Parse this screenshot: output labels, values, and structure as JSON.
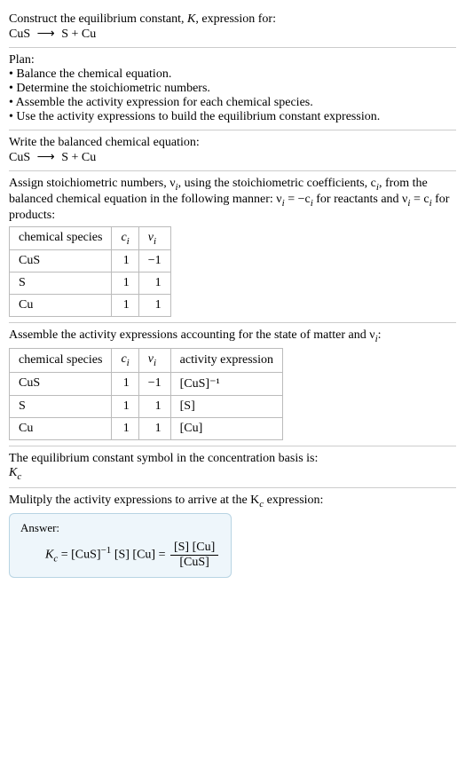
{
  "header": {
    "line1": "Construct the equilibrium constant, K, expression for:",
    "eq_lhs": "CuS",
    "eq_arrow": "⟶",
    "eq_rhs": "S + Cu"
  },
  "plan": {
    "title": "Plan:",
    "items": [
      "• Balance the chemical equation.",
      "• Determine the stoichiometric numbers.",
      "• Assemble the activity expression for each chemical species.",
      "• Use the activity expressions to build the equilibrium constant expression."
    ]
  },
  "balanced": {
    "title": "Write the balanced chemical equation:",
    "eq_lhs": "CuS",
    "eq_arrow": "⟶",
    "eq_rhs": "S + Cu"
  },
  "stoich": {
    "intro_a": "Assign stoichiometric numbers, ν",
    "intro_b": ", using the stoichiometric coefficients, c",
    "intro_c": ", from the balanced chemical equation in the following manner: ν",
    "intro_d": " = −c",
    "intro_e": " for reactants and ν",
    "intro_f": " = c",
    "intro_g": " for products:",
    "headers": {
      "species": "chemical species",
      "c": "c",
      "nu": "ν"
    },
    "rows": [
      {
        "species": "CuS",
        "c": "1",
        "nu": "−1"
      },
      {
        "species": "S",
        "c": "1",
        "nu": "1"
      },
      {
        "species": "Cu",
        "c": "1",
        "nu": "1"
      }
    ]
  },
  "activity": {
    "intro_a": "Assemble the activity expressions accounting for the state of matter and ν",
    "intro_b": ":",
    "headers": {
      "species": "chemical species",
      "c": "c",
      "nu": "ν",
      "act": "activity expression"
    },
    "rows": [
      {
        "species": "CuS",
        "c": "1",
        "nu": "−1",
        "act": "[CuS]⁻¹"
      },
      {
        "species": "S",
        "c": "1",
        "nu": "1",
        "act": "[S]"
      },
      {
        "species": "Cu",
        "c": "1",
        "nu": "1",
        "act": "[Cu]"
      }
    ]
  },
  "symbol": {
    "line1": "The equilibrium constant symbol in the concentration basis is:",
    "Kc_K": "K",
    "Kc_c": "c"
  },
  "multiply": {
    "intro_a": "Mulitply the activity expressions to arrive at the K",
    "intro_b": " expression:"
  },
  "answer": {
    "label": "Answer:",
    "K": "K",
    "c": "c",
    "eq": " = ",
    "term1": "[CuS]",
    "exp1": "−1",
    "term2": " [S] [Cu] = ",
    "frac_num": "[S] [Cu]",
    "frac_den": "[CuS]"
  },
  "sub_i": "i"
}
